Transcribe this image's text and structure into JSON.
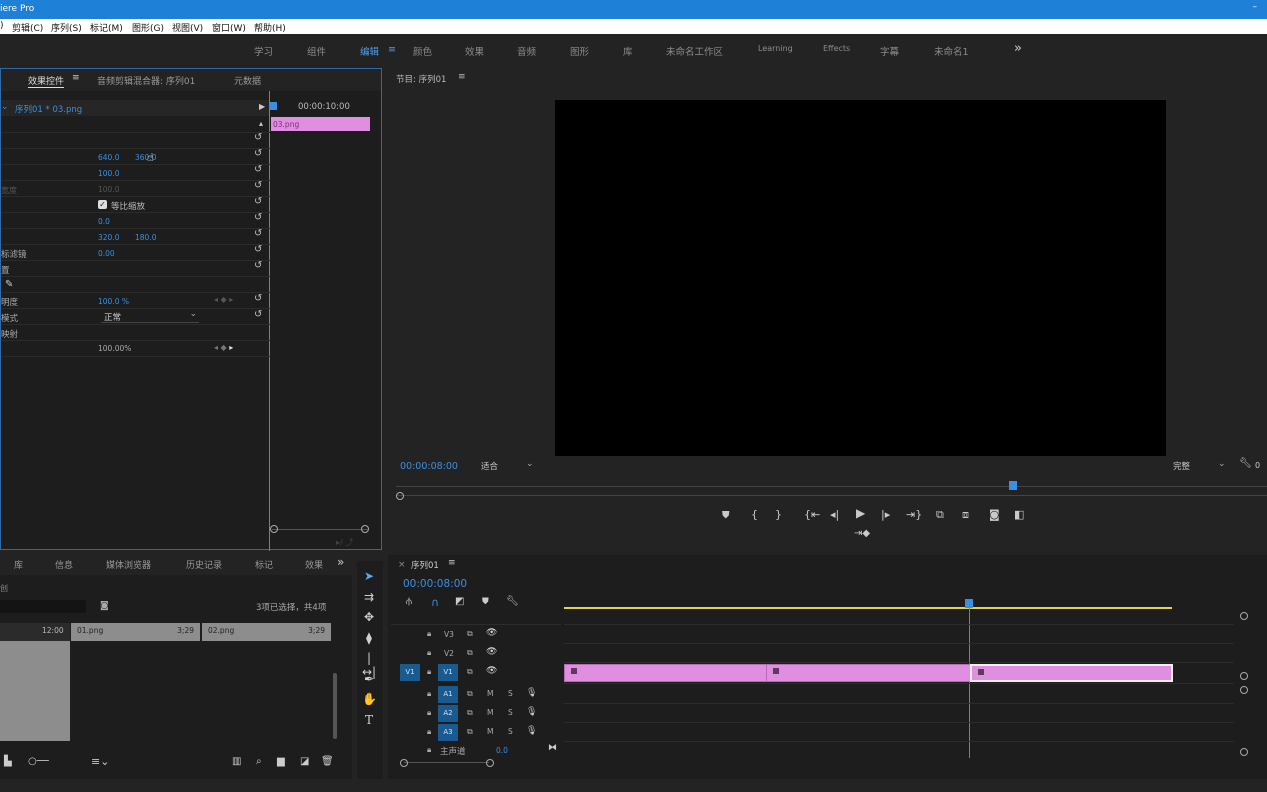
{
  "app": {
    "title": "iere Pro"
  },
  "menu": [
    "剪辑(C)",
    "序列(S)",
    "标记(M)",
    "图形(G)",
    "视图(V)",
    "窗口(W)",
    "帮助(H)"
  ],
  "workspaces": [
    "学习",
    "组件",
    "编辑",
    "颜色",
    "效果",
    "音频",
    "图形",
    "库",
    "未命名工作区",
    "Learning",
    "Effects",
    "字幕",
    "未命名1"
  ],
  "workspace_more": "»",
  "effect_controls": {
    "tabs": [
      "效果控件",
      "音频剪辑混合器: 序列01",
      "元数据"
    ],
    "header": "序列01 * 03.png",
    "timecode": "00:00:10:00",
    "clip_label": "03.png",
    "position_x": "640.0",
    "position_y": "360.0",
    "scale": "100.0",
    "scale_width_label": "宽度",
    "scale_width": "100.0",
    "uniform_scale_label": "等比缩放",
    "rotation": "0.0",
    "anchor_x": "320.0",
    "anchor_y": "180.0",
    "flicker_label": "标滤镜",
    "flicker": "0.00",
    "row_label_1": "置",
    "opacity_label": "明度",
    "opacity": "100.0 %",
    "blend_label": "模式",
    "blend_value": "正常",
    "remap_label": "映射",
    "remap": "100.00%"
  },
  "program": {
    "title": "节目: 序列01",
    "timecode": "00:00:08:00",
    "fit": "适合",
    "quality": "完整",
    "extra": "0"
  },
  "project": {
    "tabs": [
      "库",
      "信息",
      "媒体浏览器",
      "历史记录",
      "标记",
      "效果"
    ],
    "more": "»",
    "status_prefix": "创",
    "selection": "3项已选择，共4项",
    "items": [
      {
        "name": "",
        "dur": "12:00"
      },
      {
        "name": "01.png",
        "dur": "3;29"
      },
      {
        "name": "02.png",
        "dur": "3;29"
      }
    ]
  },
  "timeline": {
    "title": "序列01",
    "timecode": "00:00:08:00",
    "video_tracks": [
      "V3",
      "V2",
      "V1"
    ],
    "audio_tracks": [
      "A1",
      "A2",
      "A3"
    ],
    "source_patch": "V1",
    "mute": "M",
    "solo": "S",
    "master_label": "主声道",
    "master_value": "0.0"
  },
  "colors": {
    "accent": "#3c8fe0",
    "clip": "#e08ee0",
    "titlebar": "#1f80d8",
    "track_target": "#1a5a8e"
  }
}
